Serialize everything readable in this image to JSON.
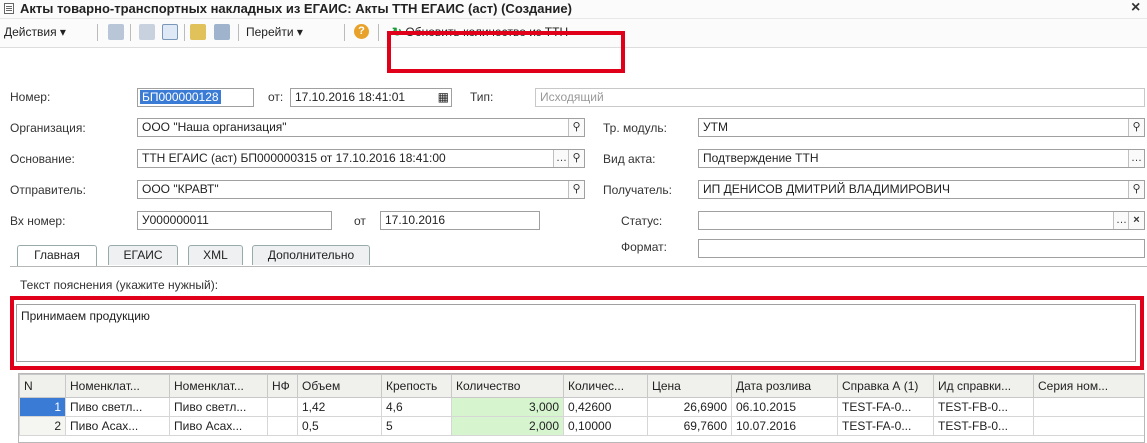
{
  "window": {
    "title": "Акты товарно-транспортных накладных из ЕГАИС: Акты ТТН ЕГАИС (аст) (Создание)"
  },
  "toolbar": {
    "actions": "Действия",
    "goto": "Перейти",
    "help": "?",
    "refresh_qty": "Обновить количество из ТТН"
  },
  "form": {
    "number_label": "Номер:",
    "number_value": "БП000000128",
    "from_label": "от:",
    "date_value": "17.10.2016 18:41:01",
    "type_label": "Тип:",
    "type_value": "Исходящий",
    "org_label": "Организация:",
    "org_value": "ООО \"Наша организация\"",
    "tr_module_label": "Тр. модуль:",
    "tr_module_value": "УТМ",
    "basis_label": "Основание:",
    "basis_value": "ТТН ЕГАИС (аст) БП000000315 от 17.10.2016 18:41:00",
    "act_type_label": "Вид акта:",
    "act_type_value": "Подтверждение ТТН",
    "sender_label": "Отправитель:",
    "sender_value": "ООО \"КРАВТ\"",
    "receiver_label": "Получатель:",
    "receiver_value": "ИП ДЕНИСОВ ДМИТРИЙ ВЛАДИМИРОВИЧ",
    "in_number_label": "Вх номер:",
    "in_number_value": "У000000011",
    "in_from_label": "от",
    "in_date_value": "17.10.2016",
    "status_label": "Статус:",
    "status_value": "",
    "format_label": "Формат:",
    "format_value": ""
  },
  "tabs": [
    "Главная",
    "ЕГАИС",
    "XML",
    "Дополнительно"
  ],
  "note": {
    "label": "Текст пояснения (укажите нужный):",
    "value": "Принимаем продукцию"
  },
  "grid": {
    "columns": [
      "N",
      "Номенклат...",
      "Номенклат...",
      "НФ",
      "Объем",
      "Крепость",
      "Количество",
      "Количес...",
      "Цена",
      "Дата розлива",
      "Справка А (1)",
      "Ид справки...",
      "Серия ном..."
    ],
    "rows": [
      [
        "1",
        "Пиво светл...",
        "Пиво светл...",
        "",
        "1,42",
        "4,6",
        "3,000",
        "0,42600",
        "26,6900",
        "06.10.2015",
        "TEST-FA-0...",
        "TEST-FB-0...",
        ""
      ],
      [
        "2",
        "Пиво Асах...",
        "Пиво Асах...",
        "",
        "0,5",
        "5",
        "2,000",
        "0,10000",
        "69,7600",
        "10.07.2016",
        "TEST-FA-0...",
        "TEST-FB-0...",
        ""
      ]
    ]
  }
}
